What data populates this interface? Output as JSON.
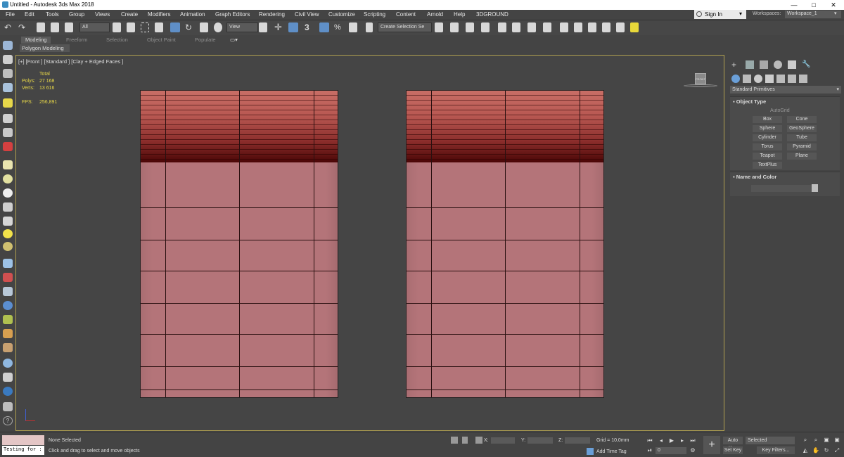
{
  "window": {
    "title": "Untitled - Autodesk 3ds Max 2018",
    "min": "—",
    "max": "□",
    "close": "✕"
  },
  "menu": [
    "File",
    "Edit",
    "Tools",
    "Group",
    "Views",
    "Create",
    "Modifiers",
    "Animation",
    "Graph Editors",
    "Rendering",
    "Civil View",
    "Customize",
    "Scripting",
    "Content",
    "Arnold",
    "Help",
    "3DGROUND"
  ],
  "account": {
    "signin": "Sign In",
    "workspaces_label": "Workspaces:",
    "workspace_value": "Workspace_1"
  },
  "toolbar": {
    "selection_filter": "All",
    "ref_coord": "View",
    "snap_angle": "3",
    "selection_set": "Create Selection Se"
  },
  "ribbon": {
    "tabs": [
      "Modeling",
      "Freeform",
      "Selection",
      "Object Paint",
      "Populate"
    ],
    "subtab": "Polygon Modeling"
  },
  "viewport": {
    "label": "[+] [Front ] [Standard ] [Clay + Edged Faces ]",
    "stats": {
      "total": "Total",
      "polys_label": "Polys:",
      "polys": "27 168",
      "verts_label": "Verts:",
      "verts": "13 616",
      "fps_label": "FPS:",
      "fps": "256,891"
    },
    "viewcube_label": "FRONT"
  },
  "command_panel": {
    "dropdown": "Standard Primitives",
    "object_type": "Object Type",
    "autogrid": "AutoGrid",
    "buttons": [
      "Box",
      "Cone",
      "Sphere",
      "GeoSphere",
      "Cylinder",
      "Tube",
      "Torus",
      "Pyramid",
      "Teapot",
      "Plane",
      "TextPlus"
    ],
    "name_color": "Name and Color"
  },
  "status": {
    "testing": "Testing for :",
    "none_selected": "None Selected",
    "hint": "Click and drag to select and move objects",
    "x_label": "X:",
    "y_label": "Y:",
    "z_label": "Z:",
    "grid": "Grid = 10,0mm",
    "add_time_tag": "Add Time Tag",
    "auto_key": "Auto Key",
    "set_key": "Set Key",
    "selected": "Selected",
    "key_filters": "Key Filters...",
    "frame": "0"
  }
}
